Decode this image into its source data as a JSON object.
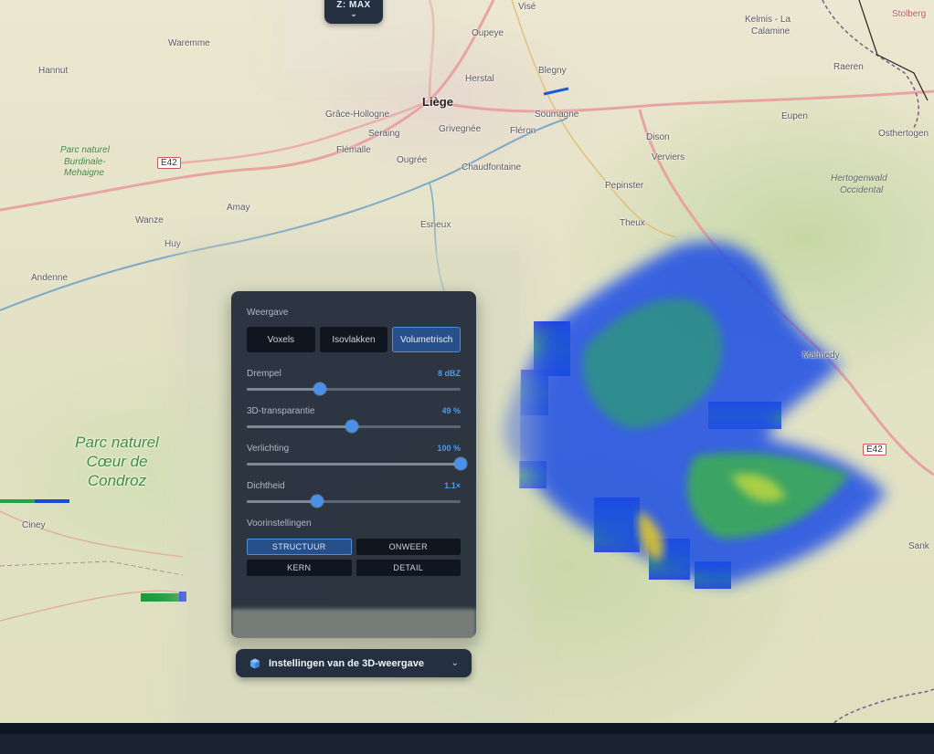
{
  "map": {
    "labels": [
      {
        "id": "waremme",
        "text": "Waremme",
        "cls": "big"
      },
      {
        "id": "hannut",
        "text": "Hannut",
        "cls": "big"
      },
      {
        "id": "oupeye",
        "text": "Oupeye",
        "cls": "big"
      },
      {
        "id": "vise",
        "text": "Visé",
        "cls": ""
      },
      {
        "id": "kelmis",
        "text": "Kelmis - La",
        "cls": ""
      },
      {
        "id": "calamine",
        "text": "Calamine",
        "cls": ""
      },
      {
        "id": "stolberg",
        "text": "Stolberg",
        "cls": ""
      },
      {
        "id": "raeren",
        "text": "Raeren",
        "cls": "big"
      },
      {
        "id": "herstal",
        "text": "Herstal",
        "cls": "big"
      },
      {
        "id": "blegny",
        "text": "Blegny",
        "cls": ""
      },
      {
        "id": "liege",
        "text": "Liège",
        "cls": "city"
      },
      {
        "id": "grace",
        "text": "Grâce-Hollogne",
        "cls": "big"
      },
      {
        "id": "soumagne",
        "text": "Soumagne",
        "cls": "big"
      },
      {
        "id": "eupen",
        "text": "Eupen",
        "cls": "big"
      },
      {
        "id": "seraing",
        "text": "Seraing",
        "cls": "big"
      },
      {
        "id": "grivegnee",
        "text": "Grivegnée",
        "cls": ""
      },
      {
        "id": "fleron",
        "text": "Fléron",
        "cls": "big"
      },
      {
        "id": "flemalle",
        "text": "Flémalle",
        "cls": "big"
      },
      {
        "id": "dison",
        "text": "Dison",
        "cls": "big"
      },
      {
        "id": "osthertogenwald",
        "text": "Osthertogen",
        "cls": ""
      },
      {
        "id": "ougree",
        "text": "Ougrée",
        "cls": ""
      },
      {
        "id": "chaudfontaine",
        "text": "Chaudfontaine",
        "cls": ""
      },
      {
        "id": "verviers",
        "text": "Verviers",
        "cls": "big"
      },
      {
        "id": "hertogenwald",
        "text": "Hertogenwald",
        "cls": "park"
      },
      {
        "id": "occidental",
        "text": "Occidental",
        "cls": "park"
      },
      {
        "id": "amay",
        "text": "Amay",
        "cls": "big"
      },
      {
        "id": "pepinster",
        "text": "Pepinster",
        "cls": ""
      },
      {
        "id": "wanze",
        "text": "Wanze",
        "cls": "big"
      },
      {
        "id": "esneux",
        "text": "Esneux",
        "cls": ""
      },
      {
        "id": "theux",
        "text": "Theux",
        "cls": "big"
      },
      {
        "id": "huy",
        "text": "Huy",
        "cls": "big"
      },
      {
        "id": "andenne",
        "text": "Andenne",
        "cls": "big"
      },
      {
        "id": "malmedy",
        "text": "Malmedy",
        "cls": ""
      },
      {
        "id": "ciney",
        "text": "Ciney",
        "cls": "big"
      },
      {
        "id": "sankt",
        "text": "Sank",
        "cls": "big"
      },
      {
        "id": "burdinale1",
        "text": "Parc naturel",
        "cls": "park"
      },
      {
        "id": "burdinale2",
        "text": "Burdinale-",
        "cls": "park"
      },
      {
        "id": "burdinale3",
        "text": "Mehaigne",
        "cls": "park"
      }
    ],
    "park_big": "Parc naturel Cœur de Condroz",
    "road_e42_left": "E42",
    "road_e42_right": "E42"
  },
  "z_chip": {
    "label": "Z: MAX",
    "chevron": "⌄"
  },
  "panel": {
    "weergave_title": "Weergave",
    "modes": [
      {
        "label": "Voxels",
        "active": false
      },
      {
        "label": "Isovlakken",
        "active": false
      },
      {
        "label": "Volumetrisch",
        "active": true
      }
    ],
    "sliders": [
      {
        "name": "Drempel",
        "value": "8 dBZ",
        "fraction": 0.34
      },
      {
        "name": "3D-transparantie",
        "value": "49 %",
        "fraction": 0.49
      },
      {
        "name": "Verlichting",
        "value": "100 %",
        "fraction": 1.0
      },
      {
        "name": "Dichtheid",
        "value": "1.1×",
        "fraction": 0.33
      }
    ],
    "presets_title": "Voorinstellingen",
    "presets": [
      {
        "label": "STRUCTUUR",
        "active": true
      },
      {
        "label": "ONWEER",
        "active": false
      },
      {
        "label": "KERN",
        "active": false
      },
      {
        "label": "DETAIL",
        "active": false
      }
    ]
  },
  "toggle": {
    "label": "Instellingen van de 3D-weergave",
    "icon": "cube-icon",
    "chevron": "⌄"
  },
  "colors": {
    "panel_bg": "#212b38",
    "accent": "#4a90e6",
    "radar_low": "#1a3ee8",
    "radar_mid": "#22c05a",
    "radar_high": "#f2d21c"
  }
}
